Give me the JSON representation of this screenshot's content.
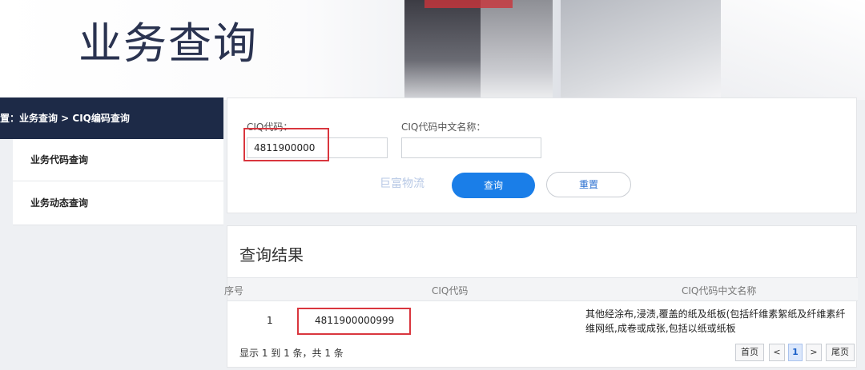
{
  "banner": {
    "title": "业务查询"
  },
  "sidebar": {
    "breadcrumb": "置：业务查询 > CIQ编码查询",
    "items": [
      {
        "label": "业务代码查询"
      },
      {
        "label": "业务动态查询"
      }
    ]
  },
  "search": {
    "ciq_code_label": "CIQ代码：",
    "ciq_code_value": "4811900000",
    "ciq_name_label": "CIQ代码中文名称：",
    "ciq_name_value": "",
    "query_button": "查询",
    "reset_button": "重置",
    "watermark": "巨富物流"
  },
  "results": {
    "title": "查询结果",
    "columns": [
      "序号",
      "CIQ代码",
      "CIQ代码中文名称"
    ],
    "rows": [
      {
        "index": "1",
        "code": "4811900000999",
        "name_line1": "其他经涂布,浸渍,覆盖的纸及纸板(包括纤维素絮纸及纤维素纤",
        "name_line2": "维网纸,成卷或成张,包括以纸或纸板"
      }
    ],
    "summary": "显示 1 到 1 条，共 1 条",
    "pager": {
      "first": "首页",
      "prev": "<",
      "current": "1",
      "next": ">",
      "last": "尾页"
    }
  },
  "colors": {
    "breadcrumb_bg": "#1d2a47",
    "primary_button": "#1a7ee8",
    "highlight_border": "#d9363e"
  }
}
